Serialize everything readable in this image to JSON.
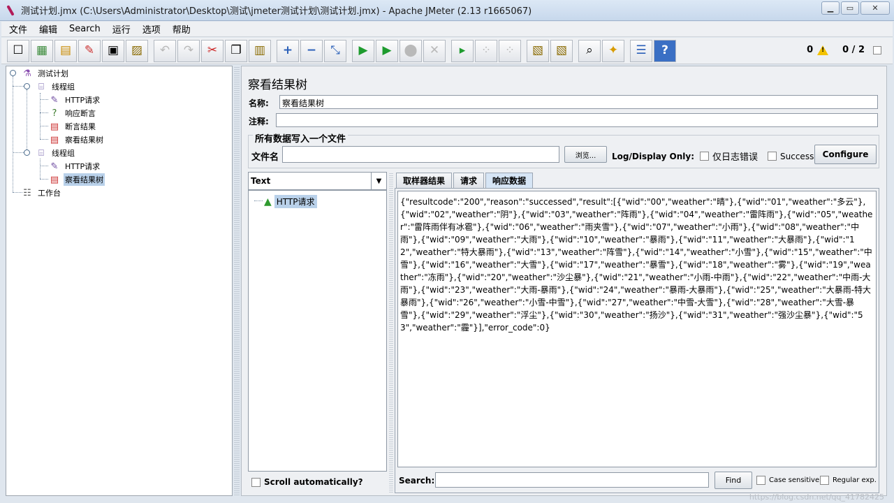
{
  "window": {
    "title": "测试计划.jmx (C:\\Users\\Administrator\\Desktop\\测试\\jmeter测试计划\\测试计划.jmx) - Apache JMeter (2.13 r1665067)",
    "buttons": [
      "minimize",
      "maximize",
      "close"
    ]
  },
  "menu": [
    "文件",
    "编辑",
    "Search",
    "运行",
    "选项",
    "帮助"
  ],
  "toolbar": {
    "buttons": [
      {
        "name": "new",
        "icon": "☐"
      },
      {
        "name": "templates",
        "icon": "▦"
      },
      {
        "name": "open",
        "icon": "▤"
      },
      {
        "name": "close",
        "icon": "✎"
      },
      {
        "name": "save",
        "icon": "▣"
      },
      {
        "name": "save-as",
        "icon": "▨"
      },
      {
        "name": "undo",
        "icon": "↶"
      },
      {
        "name": "redo",
        "icon": "↷"
      },
      {
        "name": "cut",
        "icon": "✂"
      },
      {
        "name": "copy",
        "icon": "❐"
      },
      {
        "name": "paste",
        "icon": "▥"
      },
      {
        "name": "expand",
        "icon": "+"
      },
      {
        "name": "collapse",
        "icon": "−"
      },
      {
        "name": "toggle",
        "icon": "⤡"
      },
      {
        "name": "start",
        "icon": "▶"
      },
      {
        "name": "start-no-pause",
        "icon": "▶"
      },
      {
        "name": "stop",
        "icon": "⬤"
      },
      {
        "name": "shutdown",
        "icon": "✕"
      },
      {
        "name": "remote-start",
        "icon": "▸"
      },
      {
        "name": "remote-stop",
        "icon": "⁘"
      },
      {
        "name": "remote-shutdown",
        "icon": "⁘"
      },
      {
        "name": "clear",
        "icon": "▧"
      },
      {
        "name": "clear-all",
        "icon": "▧"
      },
      {
        "name": "search",
        "icon": "⌕"
      },
      {
        "name": "reset-search",
        "icon": "✦"
      },
      {
        "name": "function-helper",
        "icon": "☰"
      },
      {
        "name": "help",
        "icon": "?"
      }
    ],
    "error_count": "0",
    "threads": "0 / 2"
  },
  "tree": {
    "nodes": [
      {
        "label": "测试计划",
        "icon": "flask-icon"
      },
      {
        "label": "线程组",
        "icon": "spool-icon"
      },
      {
        "label": "HTTP请求",
        "icon": "pipette-icon"
      },
      {
        "label": "响应断言",
        "icon": "assertion-icon"
      },
      {
        "label": "断言结果",
        "icon": "chart-icon"
      },
      {
        "label": "察看结果树",
        "icon": "chart-icon"
      },
      {
        "label": "线程组",
        "icon": "spool-icon"
      },
      {
        "label": "HTTP请求",
        "icon": "pipette-icon"
      },
      {
        "label": "察看结果树",
        "icon": "chart-icon"
      },
      {
        "label": "工作台",
        "icon": "workbench-icon"
      }
    ]
  },
  "panel": {
    "title": "察看结果树",
    "name_label": "名称:",
    "name_value": "察看结果树",
    "comment_label": "注释:",
    "comment_value": "",
    "fileset_legend": "所有数据写入一个文件",
    "filename_label": "文件名",
    "filename_value": "",
    "browse_label": "浏览...",
    "log_display_label": "Log/Display Only:",
    "errors_only_label": "仅日志错误",
    "successes_label": "Successes",
    "configure_label": "Configure"
  },
  "results": {
    "renderer": "Text",
    "samples": [
      {
        "label": "HTTP请求",
        "status": "success"
      }
    ],
    "scroll_label": "Scroll automatically?",
    "tabs": [
      "取样器结果",
      "请求",
      "响应数据"
    ],
    "active_tab": "响应数据",
    "response_text": "{\"resultcode\":\"200\",\"reason\":\"successed\",\"result\":[{\"wid\":\"00\",\"weather\":\"晴\"},{\"wid\":\"01\",\"weather\":\"多云\"},{\"wid\":\"02\",\"weather\":\"阴\"},{\"wid\":\"03\",\"weather\":\"阵雨\"},{\"wid\":\"04\",\"weather\":\"雷阵雨\"},{\"wid\":\"05\",\"weather\":\"雷阵雨伴有冰雹\"},{\"wid\":\"06\",\"weather\":\"雨夹雪\"},{\"wid\":\"07\",\"weather\":\"小雨\"},{\"wid\":\"08\",\"weather\":\"中雨\"},{\"wid\":\"09\",\"weather\":\"大雨\"},{\"wid\":\"10\",\"weather\":\"暴雨\"},{\"wid\":\"11\",\"weather\":\"大暴雨\"},{\"wid\":\"12\",\"weather\":\"特大暴雨\"},{\"wid\":\"13\",\"weather\":\"阵雪\"},{\"wid\":\"14\",\"weather\":\"小雪\"},{\"wid\":\"15\",\"weather\":\"中雪\"},{\"wid\":\"16\",\"weather\":\"大雪\"},{\"wid\":\"17\",\"weather\":\"暴雪\"},{\"wid\":\"18\",\"weather\":\"雾\"},{\"wid\":\"19\",\"weather\":\"冻雨\"},{\"wid\":\"20\",\"weather\":\"沙尘暴\"},{\"wid\":\"21\",\"weather\":\"小雨-中雨\"},{\"wid\":\"22\",\"weather\":\"中雨-大雨\"},{\"wid\":\"23\",\"weather\":\"大雨-暴雨\"},{\"wid\":\"24\",\"weather\":\"暴雨-大暴雨\"},{\"wid\":\"25\",\"weather\":\"大暴雨-特大暴雨\"},{\"wid\":\"26\",\"weather\":\"小雪-中雪\"},{\"wid\":\"27\",\"weather\":\"中雪-大雪\"},{\"wid\":\"28\",\"weather\":\"大雪-暴雪\"},{\"wid\":\"29\",\"weather\":\"浮尘\"},{\"wid\":\"30\",\"weather\":\"扬沙\"},{\"wid\":\"31\",\"weather\":\"强沙尘暴\"},{\"wid\":\"53\",\"weather\":\"霾\"}],\"error_code\":0}",
    "search_label": "Search:",
    "search_value": "",
    "find_label": "Find",
    "case_sensitive_label": "Case sensitive",
    "regex_label": "Regular exp."
  },
  "watermark": "https://blog.csdn.net/qq_41782425"
}
